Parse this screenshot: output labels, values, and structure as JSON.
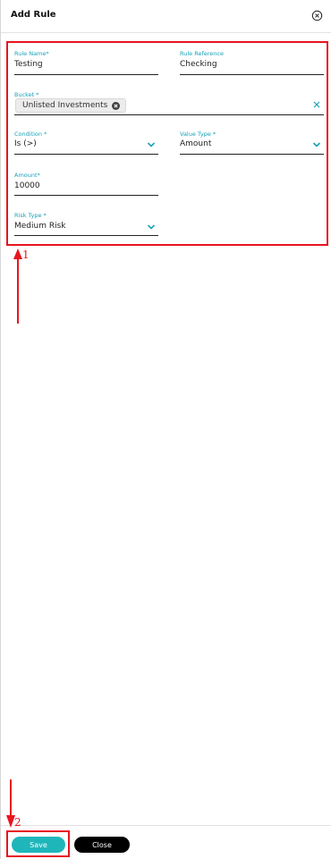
{
  "header": {
    "title": "Add Rule",
    "close_icon": "close-circle-icon"
  },
  "form": {
    "rule_name": {
      "label": "Rule Name*",
      "value": "Testing"
    },
    "rule_reference": {
      "label": "Rule Reference",
      "value": "Checking"
    },
    "bucket": {
      "label": "Bucket *",
      "chips": [
        "Unlisted Investments"
      ],
      "clear_icon": "clear-icon"
    },
    "condition": {
      "label": "Condition *",
      "value": "Is (>)"
    },
    "value_type": {
      "label": "Value Type *",
      "value": "Amount"
    },
    "amount": {
      "label": "Amount*",
      "value": "10000"
    },
    "risk_type": {
      "label": "Risk Type *",
      "value": "Medium Risk"
    }
  },
  "footer": {
    "save_label": "Save",
    "close_label": "Close"
  },
  "annotations": {
    "marker_1": "1",
    "marker_2": "2"
  },
  "colors": {
    "accent": "#1fb6ba",
    "label": "#17a2b8",
    "annotation": "#e8141f"
  }
}
